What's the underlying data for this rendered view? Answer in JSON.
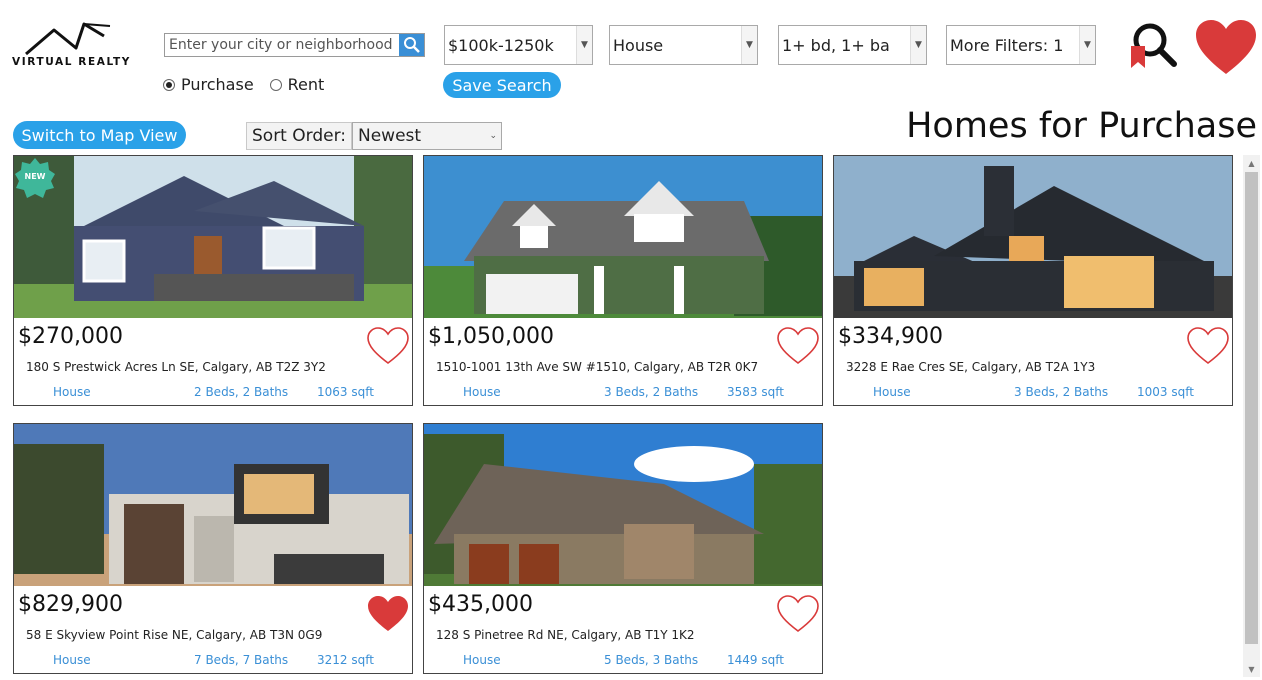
{
  "brand": {
    "name": "VIRTUAL REALTY"
  },
  "search": {
    "placeholder": "Enter your city or neighborhood",
    "value": "",
    "options": [
      {
        "label": "Purchase",
        "selected": true
      },
      {
        "label": "Rent",
        "selected": false
      }
    ],
    "save_label": "Save Search"
  },
  "filters": {
    "price": "$100k-1250k",
    "type": "House",
    "beds_baths": "1+ bd, 1+ ba",
    "more": "More Filters: 1"
  },
  "header_icons": {
    "saved_search": "magnifier-bookmark-icon",
    "favorites": "heart-icon"
  },
  "toolbar": {
    "map_view_label": "Switch to Map View",
    "sort_label": "Sort Order:",
    "sort_value": "Newest"
  },
  "page": {
    "title": "Homes for Purchase"
  },
  "colors": {
    "accent": "#2aa1e8",
    "link": "#3a8fd6",
    "heart": "#d93a3a",
    "new_badge": "#3fb79a"
  },
  "listings": [
    {
      "price": "$270,000",
      "address": "180 S Prestwick Acres Ln SE, Calgary, AB T2Z 3Y2",
      "type": "House",
      "beds_baths": "2 Beds, 2 Baths",
      "sqft": "1063 sqft",
      "favorite": false,
      "badge": "NEW"
    },
    {
      "price": "$1,050,000",
      "address": "1510-1001 13th Ave SW #1510, Calgary, AB T2R 0K7",
      "type": "House",
      "beds_baths": "3 Beds, 2 Baths",
      "sqft": "3583 sqft",
      "favorite": false
    },
    {
      "price": "$334,900",
      "address": "3228 E Rae Cres SE, Calgary, AB T2A 1Y3",
      "type": "House",
      "beds_baths": "3 Beds, 2 Baths",
      "sqft": "1003 sqft",
      "favorite": false
    },
    {
      "price": "$829,900",
      "address": "58 E Skyview Point Rise NE, Calgary, AB T3N 0G9",
      "type": "House",
      "beds_baths": "7 Beds, 7 Baths",
      "sqft": "3212 sqft",
      "favorite": true
    },
    {
      "price": "$435,000",
      "address": "128 S Pinetree Rd NE, Calgary, AB T1Y 1K2",
      "type": "House",
      "beds_baths": "5 Beds, 3 Baths",
      "sqft": "1449 sqft",
      "favorite": false
    }
  ]
}
